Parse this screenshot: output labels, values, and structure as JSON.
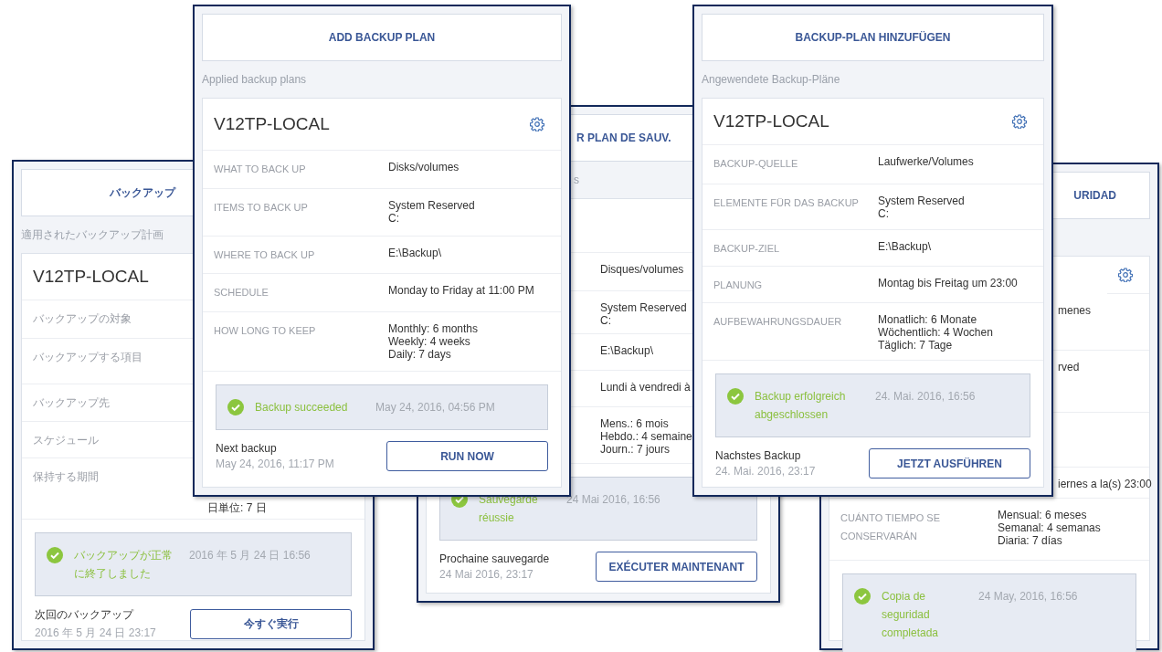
{
  "windows": [
    {
      "header": "バックアップ",
      "applied_label": "適用されたバックアップ計画",
      "title": "V12TP-LOCAL",
      "rows": [
        {
          "label": "バックアップの対象"
        },
        {
          "label": "バックアップする項目"
        },
        {
          "label": "バックアップ先"
        },
        {
          "label": "スケジュール"
        },
        {
          "label": "保持する期間",
          "value": "日単位: 7 日"
        }
      ],
      "status": {
        "text": "バックアップが正常に終了しました",
        "time": "2016 年 5 月 24 日 16:56"
      },
      "next": {
        "label": "次回のバックアップ",
        "time": "2016 年 5 月 24 日 23:17"
      },
      "button": "今すぐ実行"
    },
    {
      "header": "ADD BACKUP PLAN",
      "applied_label": "Applied backup plans",
      "title": "V12TP-LOCAL",
      "settings": true,
      "rows": [
        {
          "label": "WHAT TO BACK UP",
          "value": "Disks/volumes"
        },
        {
          "label": "ITEMS TO BACK UP",
          "value": "System Reserved\nC:"
        },
        {
          "label": "WHERE TO BACK UP",
          "value": "E:\\Backup\\"
        },
        {
          "label": "SCHEDULE",
          "value": "Monday to Friday at 11:00 PM"
        },
        {
          "label": "HOW LONG TO KEEP",
          "value": "Monthly: 6 months\nWeekly: 4 weeks\nDaily: 7 days"
        }
      ],
      "status": {
        "text": "Backup succeeded",
        "time": "May 24, 2016, 04:56 PM"
      },
      "next": {
        "label": "Next backup",
        "time": "May 24, 2016, 11:17 PM"
      },
      "button": "RUN NOW"
    },
    {
      "header": "R PLAN DE SAUV.",
      "applied_label": "s",
      "rows": [
        {
          "value": "Disques/volumes"
        },
        {
          "value": "System Reserved\nC:"
        },
        {
          "value": "E:\\Backup\\"
        },
        {
          "value": "Lundi à vendredi à"
        },
        {
          "value": "Mens.: 6 mois\nHebdo.: 4 semaine\nJourn.: 7 jours"
        }
      ],
      "status": {
        "text": "Sauvegarde réussie",
        "time": "24 Mai 2016, 16:56"
      },
      "next": {
        "label": "Prochaine sauvegarde",
        "time": "24 Mai 2016, 23:17"
      },
      "button": "EXÉCUTER MAINTENANT"
    },
    {
      "header": "BACKUP-PLAN HINZUFÜGEN",
      "applied_label": "Angewendete Backup-Pläne",
      "title": "V12TP-LOCAL",
      "settings": true,
      "rows": [
        {
          "label": "BACKUP-QUELLE",
          "value": "Laufwerke/Volumes"
        },
        {
          "label": "ELEMENTE FÜR DAS BACKUP",
          "value": "System Reserved\nC:"
        },
        {
          "label": "BACKUP-ZIEL",
          "value": "E:\\Backup\\"
        },
        {
          "label": "PLANUNG",
          "value": "Montag bis Freitag um 23:00"
        },
        {
          "label": "AUFBEWAHRUNGSDAUER",
          "value": "Monatlich: 6 Monate\nWöchentlich: 4 Wochen\nTäglich: 7 Tage"
        }
      ],
      "status": {
        "text": "Backup erfolgreich abgeschlossen",
        "time": "24. Mai. 2016, 16:56"
      },
      "next": {
        "label": "Nachstes Backup",
        "time": "24. Mai. 2016, 23:17"
      },
      "button": "JETZT AUSFÜHREN"
    },
    {
      "header": "URIDAD",
      "settings": true,
      "rows": [
        {
          "value": "menes"
        },
        {
          "value": "rved"
        },
        {},
        {
          "value": "iernes a la(s) 23:00"
        },
        {
          "label": "CUÁNTO TIEMPO SE CONSERVARÁN",
          "value": "Mensual: 6 meses\nSemanal: 4 semanas\nDiaria: 7 días"
        }
      ],
      "status": {
        "text": "Copia de seguridad completada",
        "time": "24 May, 2016, 16:56"
      }
    }
  ]
}
